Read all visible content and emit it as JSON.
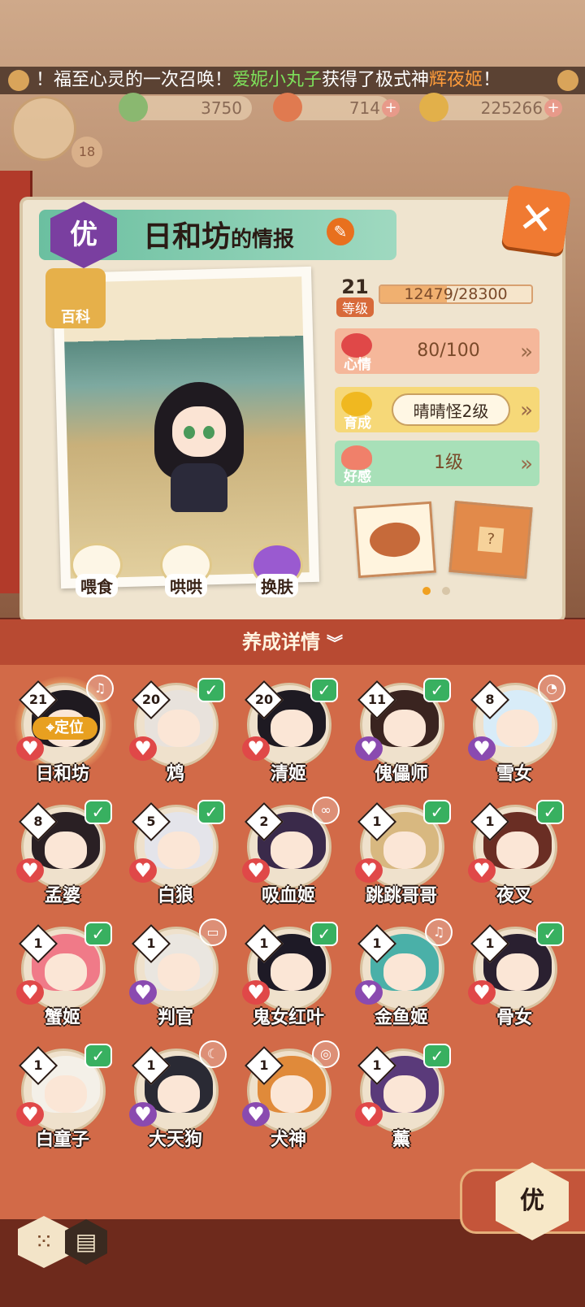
{
  "marquee": {
    "prefix": "！福至心灵的一次召唤！",
    "player": "爱妮小丸子",
    "middle": "获得了极式神",
    "shikigami": "辉夜姬",
    "suffix": "！"
  },
  "resources": {
    "jade": "3750",
    "stamina": "714",
    "coins": "225266",
    "player_level": "18"
  },
  "card": {
    "grade": "优",
    "title": "日和坊",
    "title_suffix": "的情报",
    "wiki_label": "百科",
    "level_value": "21",
    "level_label": "等级",
    "xp_text": "12479/28300",
    "xp_progress": 0.44,
    "mood_label": "心情",
    "mood_value": "80/100",
    "raise_label": "育成",
    "raise_value": "晴晴怪2级",
    "fav_label": "好感",
    "fav_value": "1级",
    "actions": [
      "喂食",
      "哄哄",
      "换肤"
    ]
  },
  "roster": {
    "header": "养成详情",
    "locate_label": "定位",
    "items": [
      {
        "name": "日和坊",
        "level": "21",
        "state": "bell",
        "mood": "red",
        "hair": "#1f1a20",
        "selected": true
      },
      {
        "name": "鸩",
        "level": "20",
        "state": "check",
        "mood": "red",
        "hair": "#e8e2dc"
      },
      {
        "name": "清姬",
        "level": "20",
        "state": "check",
        "mood": "red",
        "hair": "#1e1a22"
      },
      {
        "name": "傀儡师",
        "level": "11",
        "state": "check",
        "mood": "purple",
        "hair": "#3a2420"
      },
      {
        "name": "雪女",
        "level": "8",
        "state": "cup",
        "mood": "purple",
        "hair": "#d8ecf8"
      },
      {
        "name": "孟婆",
        "level": "8",
        "state": "check",
        "mood": "red",
        "hair": "#2a2024"
      },
      {
        "name": "白狼",
        "level": "5",
        "state": "check",
        "mood": "red",
        "hair": "#e4e4ea"
      },
      {
        "name": "吸血姬",
        "level": "2",
        "state": "infinity",
        "mood": "red",
        "hair": "#3a2a4a"
      },
      {
        "name": "跳跳哥哥",
        "level": "1",
        "state": "check",
        "mood": "red",
        "hair": "#d8b880"
      },
      {
        "name": "夜叉",
        "level": "1",
        "state": "check",
        "mood": "red",
        "hair": "#6a2e24"
      },
      {
        "name": "蟹姬",
        "level": "1",
        "state": "check",
        "mood": "red",
        "hair": "#f07a88"
      },
      {
        "name": "判官",
        "level": "1",
        "state": "paper",
        "mood": "purple",
        "hair": "#eae6e0"
      },
      {
        "name": "鬼女红叶",
        "level": "1",
        "state": "check",
        "mood": "red",
        "hair": "#1e1a26"
      },
      {
        "name": "金鱼姬",
        "level": "1",
        "state": "bell",
        "mood": "purple",
        "hair": "#4ab0a8"
      },
      {
        "name": "骨女",
        "level": "1",
        "state": "check",
        "mood": "red",
        "hair": "#2a2030"
      },
      {
        "name": "白童子",
        "level": "1",
        "state": "check",
        "mood": "red",
        "hair": "#f4f0e8"
      },
      {
        "name": "大天狗",
        "level": "1",
        "state": "moon",
        "mood": "purple",
        "hair": "#2a2a34"
      },
      {
        "name": "犬神",
        "level": "1",
        "state": "ring",
        "mood": "purple",
        "hair": "#e08a3a"
      },
      {
        "name": "薰",
        "level": "1",
        "state": "check",
        "mood": "red",
        "hair": "#5a3a7a"
      }
    ]
  },
  "bottom": {
    "grade_button": "优"
  },
  "colors": {
    "accent_orange": "#f07a32",
    "roster_bg": "#d26a48",
    "check_green": "#38b060",
    "mood_red": "#e04848",
    "mood_purple": "#8a4ab0"
  }
}
